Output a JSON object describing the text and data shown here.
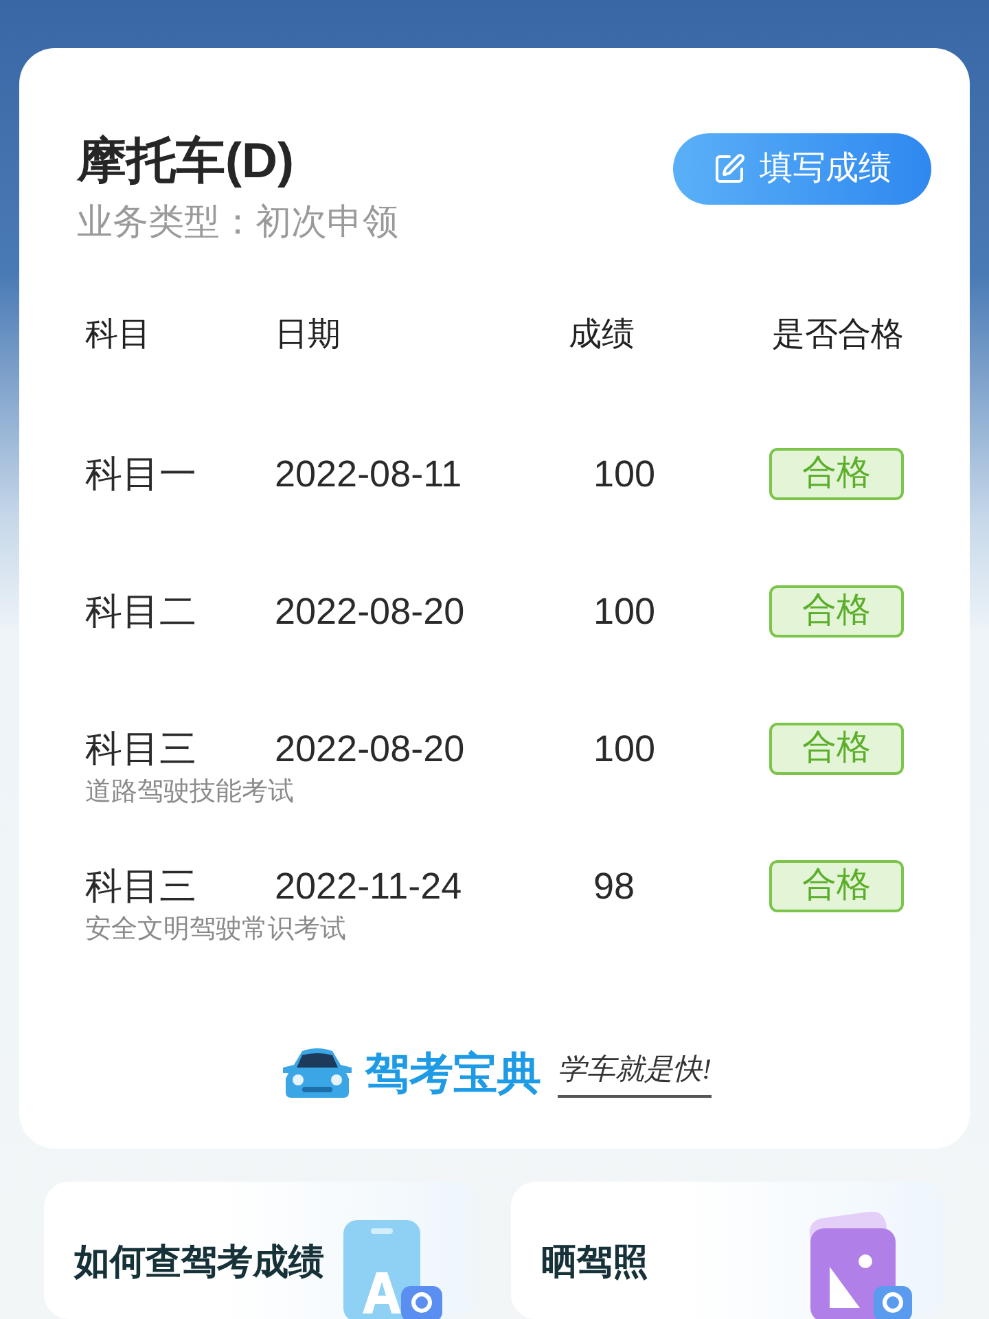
{
  "vehicle": {
    "title": "摩托车(D)",
    "business_type": "业务类型：初次申领",
    "fill_button": "填写成绩"
  },
  "table": {
    "columns": [
      "科目",
      "日期",
      "成绩",
      "是否合格"
    ],
    "rows": [
      {
        "subject": "科目一",
        "date": "2022-08-11",
        "score": "100",
        "result": "合格",
        "passed": true
      },
      {
        "subject": "科目二",
        "date": "2022-08-20",
        "score": "100",
        "result": "合格",
        "passed": true
      },
      {
        "subject": "科目三",
        "note": "道路驾驶技能考试",
        "date": "2022-08-20",
        "score": "100",
        "result": "合格",
        "passed": true
      },
      {
        "subject": "科目三",
        "note": "安全文明驾驶常识考试",
        "date": "2022-11-24",
        "score": "98",
        "result": "合格",
        "passed": true
      }
    ]
  },
  "brand": {
    "name": "驾考宝典",
    "slogan": "学车就是快!"
  },
  "links": [
    {
      "label": "如何查驾考成绩",
      "kind": "doc"
    },
    {
      "label": "晒驾照",
      "kind": "photo"
    }
  ]
}
